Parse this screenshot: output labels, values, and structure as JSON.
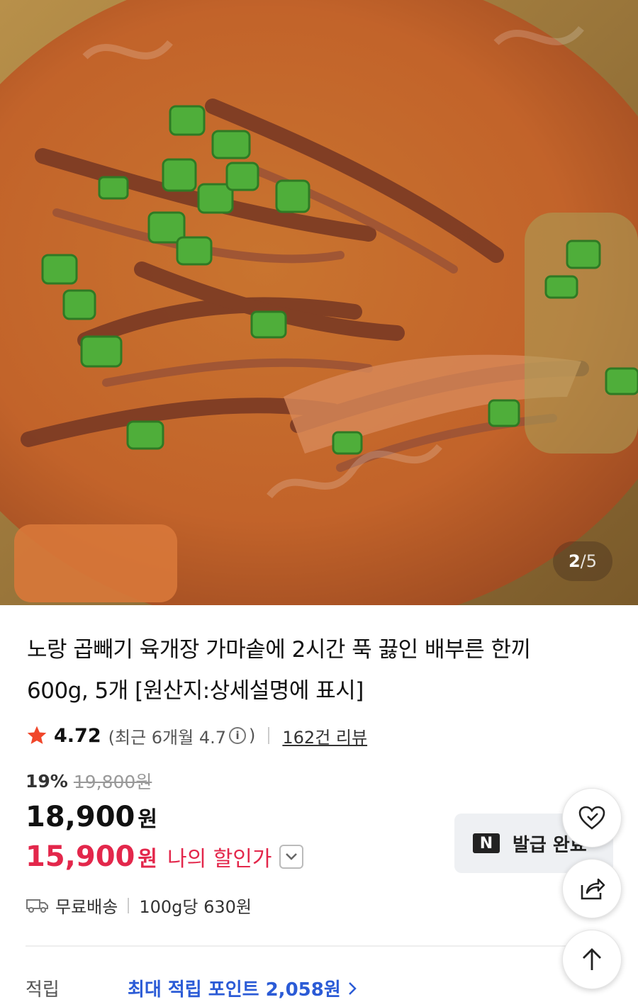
{
  "image_counter": {
    "current": "2",
    "separator": "/",
    "total": "5"
  },
  "product": {
    "title_line1": "노랑 곱빼기 육개장 가마솥에 2시간 푹 끓인 배부른 한끼",
    "title_line2": "600g, 5개 [원산지:상세설명에 표시]"
  },
  "rating": {
    "score": "4.72",
    "recent_prefix": "(최근 6개월 4.7",
    "recent_suffix": ")",
    "reviews": "162건 리뷰"
  },
  "pricing": {
    "discount_pct": "19%",
    "original_price": "19,800원",
    "price": "18,900",
    "price_unit": "원",
    "my_price": "15,900",
    "my_price_unit": "원",
    "my_price_label": "나의 할인가"
  },
  "coupon": {
    "logo": "N",
    "label": "발급 완료"
  },
  "shipping": {
    "free": "무료배송",
    "unit_price": "100g당 630원"
  },
  "points": {
    "label": "적립",
    "value": "최대 적립 포인트 2,058원"
  },
  "icons": {
    "rating": "star-icon",
    "info": "info-icon",
    "dropdown": "chevron-down-icon",
    "shipping": "truck-icon",
    "points_more": "chevron-right-icon",
    "like": "heart-icon",
    "share": "share-icon",
    "top": "arrow-up-icon"
  },
  "colors": {
    "accent_red": "#e3274b",
    "link_blue": "#2b5bd6",
    "star": "#f0462a"
  }
}
